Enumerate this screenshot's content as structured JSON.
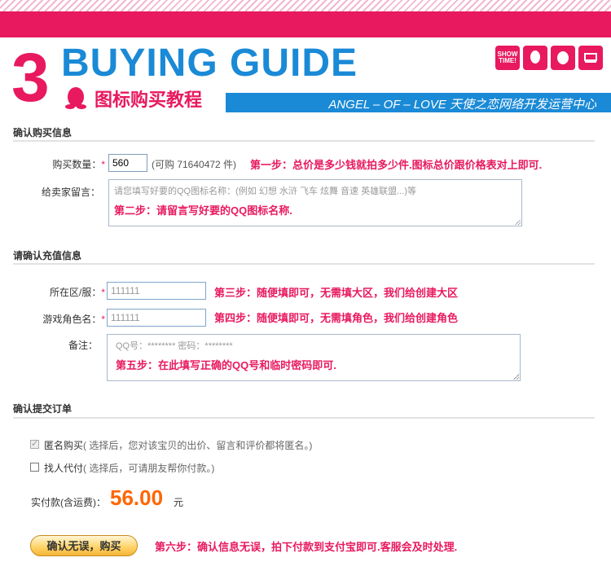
{
  "header": {
    "step_number": "3",
    "title": "BUYING GUIDE",
    "subtitle_cn": "图标购买教程",
    "subtitle_en": "ANGEL – OF – LOVE 天使之恋网络开发运营中心",
    "badges": [
      "SHOW TIME!",
      "",
      "",
      ""
    ]
  },
  "section1": {
    "heading": "确认购买信息",
    "qty_label": "购买数量：",
    "qty_value": "560",
    "qty_avail": "(可购 71640472 件)",
    "qty_note": "第一步：总价是多少钱就拍多少件.图标总价跟价格表对上即可.",
    "msg_label": "给卖家留言：",
    "msg_placeholder": "请您填写好要的QQ图标名称：(例如 幻想 水浒 飞车 炫舞 音速 英雄联盟...)等",
    "msg_note": "第二步：请留言写好要的QQ图标名称."
  },
  "section2": {
    "heading": "请确认充值信息",
    "area_label": "所在区/服：",
    "area_value": "111111",
    "area_note": "第三步：随便填即可，无需填大区，我们给创建大区",
    "role_label": "游戏角色名：",
    "role_value": "111111",
    "role_note": "第四步：随便填即可，无需填角色，我们给创建角色",
    "remark_label": "备注：",
    "remark_placeholder": "QQ号：******** 密码：********",
    "remark_note": "第五步：在此填写正确的QQ号和临时密码即可."
  },
  "section3": {
    "heading": "确认提交订单",
    "anon_label": "匿名购买",
    "anon_hint": "( 选择后，您对该宝贝的出价、留言和评价都将匿名。)",
    "anon_checked": true,
    "proxy_label": "找人代付",
    "proxy_hint": "( 选择后，可请朋友帮你付款。)",
    "proxy_checked": false,
    "pay_label": "实付款(含运费)：",
    "price": "56.00",
    "unit": "元",
    "submit_label": "确认无误，购买",
    "submit_note": "第六步：确认信息无误，拍下付款到支付宝即可.客服会及时处理."
  },
  "colors": {
    "pink": "#e8195f",
    "blue": "#1a8ad6",
    "orange": "#ff6600"
  }
}
